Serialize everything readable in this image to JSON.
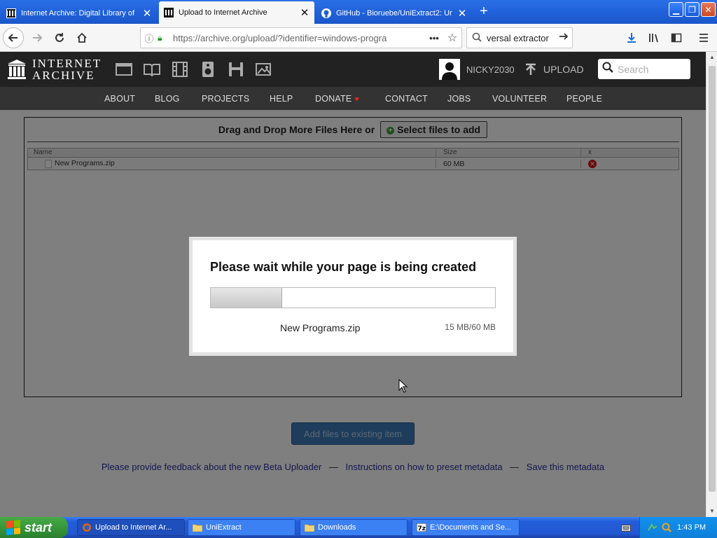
{
  "browser": {
    "tabs": [
      {
        "label": "Internet Archive: Digital Library of",
        "close": "✕",
        "active": false
      },
      {
        "label": "Upload to Internet Archive",
        "close": "✕",
        "active": true
      },
      {
        "label": "GitHub - Bioruebe/UniExtract2: Un",
        "close": "✕",
        "active": false
      }
    ],
    "new_tab": "+",
    "url": "https://archive.org/upload/?identifier=windows-progra",
    "search_value": "versal extractor"
  },
  "ia_header": {
    "logo_line1": "INTERNET",
    "logo_line2": "ARCHIVE",
    "username": "NICKY2030",
    "upload_label": "UPLOAD",
    "search_placeholder": "Search",
    "nav": [
      "ABOUT",
      "BLOG",
      "PROJECTS",
      "HELP",
      "DONATE",
      "CONTACT",
      "JOBS",
      "VOLUNTEER",
      "PEOPLE"
    ],
    "donate_heart": "♥"
  },
  "uploader": {
    "drop_text": "Drag and Drop More Files Here or",
    "select_button": "Select files to add",
    "table": {
      "headers": {
        "name": "Name",
        "size": "Size",
        "remove": "x"
      },
      "rows": [
        {
          "name": "New Programs.zip",
          "size": "60 MB"
        }
      ]
    },
    "add_button": "Add files to existing item",
    "links": [
      "Please provide feedback about the new Beta Uploader",
      "Instructions on how to preset metadata",
      "Save this metadata"
    ],
    "link_sep": "—"
  },
  "modal": {
    "title": "Please wait while your page is being created",
    "filename": "New Programs.zip",
    "size_progress": "15 MB/60 MB",
    "progress_fraction": 0.25
  },
  "taskbar": {
    "start_label": "start",
    "tasks": [
      {
        "label": "Upload to Internet Ar...",
        "active": true
      },
      {
        "label": "UniExtract",
        "active": false
      },
      {
        "label": "Downloads",
        "active": false
      },
      {
        "label": "E:\\Documents and Se...",
        "active": false
      }
    ],
    "clock": "1:43 PM"
  },
  "colors": {
    "xp_blue": "#245edb",
    "ia_dark": "#222222",
    "link_blue": "#2c2ca0",
    "add_button": "#3d7ab8"
  }
}
